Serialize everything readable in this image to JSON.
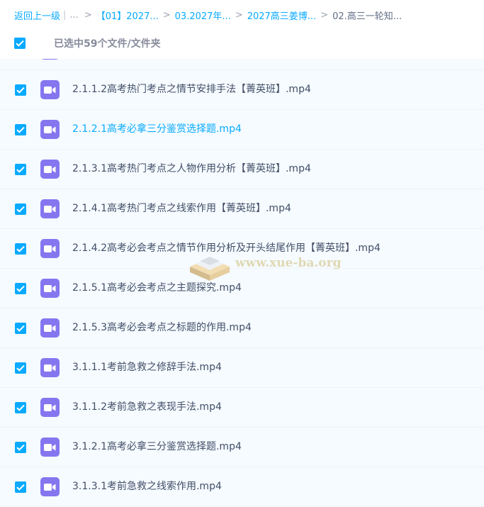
{
  "breadcrumb": {
    "back_label": "返回上一级",
    "pipe": "|",
    "ellipsis": "...",
    "separator": ">",
    "crumbs": [
      "【01】2027...",
      "03.2027年...",
      "2027高三姜博..."
    ],
    "current": "02.高三一轮知..."
  },
  "selection": {
    "status_text": "已选中59个文件/文件夹"
  },
  "watermark_text": "www.xue-ba.org",
  "file_icon": "video-file-icon",
  "colors": {
    "accent": "#09aaff",
    "video_icon": "#8576f0",
    "row_bg": "#f5fbff"
  },
  "files": [
    {
      "name": "2.1.1.2高考热门考点之情节安排手法【菁英班】.mp4"
    },
    {
      "name": "2.1.2.1高考必拿三分鉴赏选择题.mp4"
    },
    {
      "name": "2.1.3.1高考热门考点之人物作用分析【菁英班】.mp4"
    },
    {
      "name": "2.1.4.1高考热门考点之线索作用【菁英班】.mp4"
    },
    {
      "name": "2.1.4.2高考必会考点之情节作用分析及开头结尾作用【菁英班】.mp4"
    },
    {
      "name": "2.1.5.1高考必会考点之主题探究.mp4"
    },
    {
      "name": "2.1.5.3高考必会考点之标题的作用.mp4"
    },
    {
      "name": "3.1.1.1考前急救之修辞手法.mp4"
    },
    {
      "name": "3.1.1.2考前急救之表现手法.mp4"
    },
    {
      "name": "3.1.2.1高考必拿三分鉴赏选择题.mp4"
    },
    {
      "name": "3.1.3.1考前急救之线索作用.mp4"
    }
  ]
}
